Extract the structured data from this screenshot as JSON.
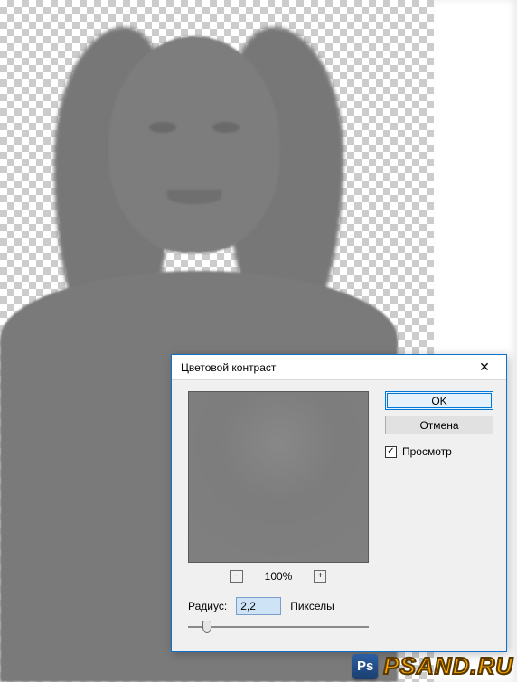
{
  "canvas": {
    "description": "portrait-high-pass-preview"
  },
  "dialog": {
    "title": "Цветовой контраст",
    "close": "✕",
    "zoom": {
      "minus": "−",
      "value": "100%",
      "plus": "+"
    },
    "radius": {
      "label": "Радиус:",
      "value": "2,2",
      "units": "Пикселы",
      "slider_pct": 8
    },
    "buttons": {
      "ok": "OK",
      "cancel": "Отмена"
    },
    "preview_checkbox": {
      "checked": true,
      "label": "Просмотр",
      "mark": "✓"
    }
  },
  "watermark": {
    "icon": "Ps",
    "text": "PSAND.RU"
  }
}
